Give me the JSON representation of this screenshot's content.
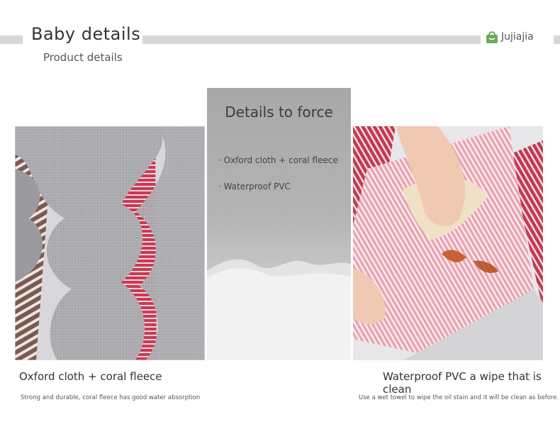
{
  "header": {
    "title": "Baby details",
    "subtitle": "Product details",
    "brand": "Jujiajia",
    "brand_icon": "shopping-bag-icon",
    "brand_color": "#6aaa57"
  },
  "panel": {
    "title": "Details to force",
    "items": [
      "· Oxford cloth + coral fleece",
      "· Waterproof PVC"
    ]
  },
  "left": {
    "caption": "Oxford cloth + coral fleece",
    "description": "Strong and durable, coral fleece has good water absorption"
  },
  "right": {
    "caption": "Waterproof PVC a wipe that is clean",
    "description": "Use a wet towel to wipe the oil stain and it will be clean as before."
  },
  "colors": {
    "stripe_red": "#c83a55",
    "fleece_grey": "#a9a9ad",
    "bar_grey": "#d6d6d6"
  }
}
